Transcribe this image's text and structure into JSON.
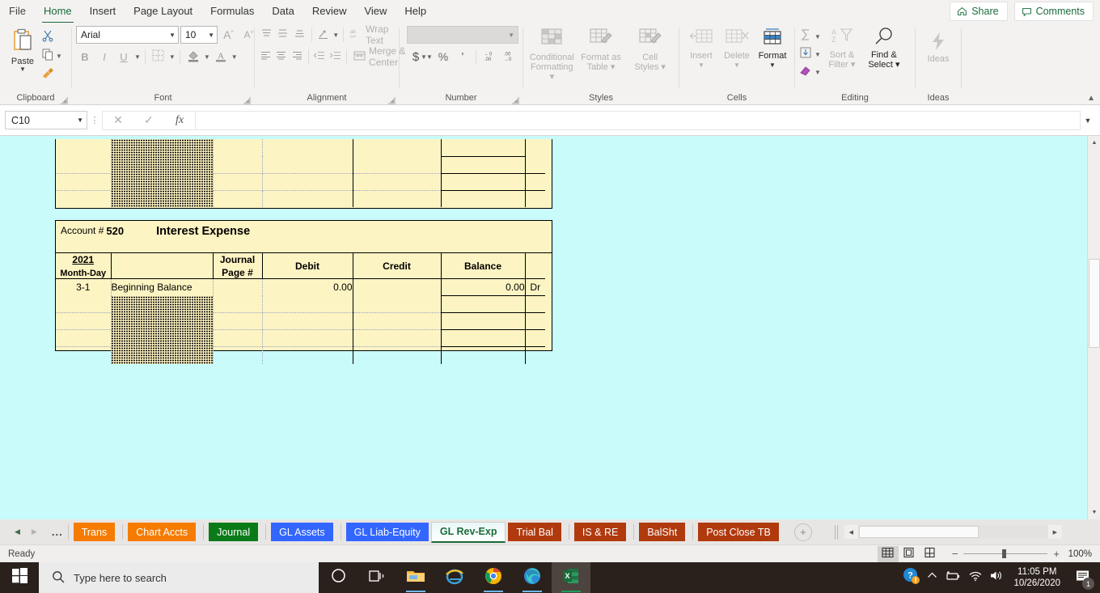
{
  "ribbon": {
    "tabs": [
      {
        "label": "File",
        "active": false
      },
      {
        "label": "Home",
        "active": true
      },
      {
        "label": "Insert",
        "active": false
      },
      {
        "label": "Page Layout",
        "active": false
      },
      {
        "label": "Formulas",
        "active": false
      },
      {
        "label": "Data",
        "active": false
      },
      {
        "label": "Review",
        "active": false
      },
      {
        "label": "View",
        "active": false
      },
      {
        "label": "Help",
        "active": false
      }
    ],
    "share_label": "Share",
    "comments_label": "Comments",
    "groups": {
      "clipboard": {
        "label": "Clipboard",
        "paste_label": "Paste",
        "cut_name": "cut-icon",
        "copy_name": "copy-icon",
        "format_painter_name": "format-painter-icon"
      },
      "font": {
        "label": "Font",
        "font_name": "Arial",
        "font_size": "10",
        "bold_label": "B",
        "italic_label": "I",
        "underline_label": "U",
        "grow_label": "A",
        "shrink_label": "A"
      },
      "alignment": {
        "label": "Alignment",
        "wrap_text_label": "Wrap Text",
        "merge_center_label": "Merge & Center"
      },
      "number": {
        "label": "Number",
        "format_value": "",
        "accounting_label": "$",
        "percent_label": "%",
        "comma_label": "'"
      },
      "styles": {
        "label": "Styles",
        "conditional_formatting_label": "Conditional\nFormatting",
        "conditional_formatting_l1": "Conditional",
        "conditional_formatting_l2": "Formatting",
        "format_as_table_l1": "Format as",
        "format_as_table_l2": "Table",
        "cell_styles_l1": "Cell",
        "cell_styles_l2": "Styles"
      },
      "cells": {
        "label": "Cells",
        "insert_label": "Insert",
        "delete_label": "Delete",
        "format_label": "Format"
      },
      "editing": {
        "label": "Editing",
        "sort_filter_l1": "Sort &",
        "sort_filter_l2": "Filter",
        "find_select_l1": "Find &",
        "find_select_l2": "Select"
      },
      "ideas": {
        "label": "Ideas",
        "ideas_button_label": "Ideas"
      }
    }
  },
  "formula_bar": {
    "name_box_value": "C10",
    "formula_value": "",
    "cancel_icon": "close-icon",
    "enter_icon": "check-icon",
    "function_icon": "fx-icon"
  },
  "worksheet": {
    "background_color": "#c9fbfb",
    "cell_fill_color": "#fdf4c3",
    "ledger_top": {
      "rows": [
        {
          "date": "",
          "desc": "",
          "jp": "",
          "debit": "",
          "credit": "",
          "balance": "",
          "dr": "",
          "hatched": true
        },
        {
          "date": "",
          "desc": "",
          "jp": "",
          "debit": "",
          "credit": "",
          "balance": "",
          "dr": "",
          "hatched": true
        },
        {
          "date": "",
          "desc": "",
          "jp": "",
          "debit": "",
          "credit": "",
          "balance": "",
          "dr": "",
          "hatched": true
        },
        {
          "date": "",
          "desc": "",
          "jp": "",
          "debit": "",
          "credit": "",
          "balance": "",
          "dr": "",
          "hatched": true
        }
      ]
    },
    "ledger_main": {
      "account_label": "Account #",
      "account_number": "520",
      "account_title": "Interest Expense",
      "headers": {
        "year": "2021",
        "month_day": "Month-Day",
        "description": "",
        "journal_l1": "Journal",
        "journal_l2": "Page #",
        "debit": "Debit",
        "credit": "Credit",
        "balance": "Balance",
        "dr_cr": ""
      },
      "rows": [
        {
          "date": "3-1",
          "desc": "Beginning Balance",
          "jp": "",
          "debit": "0.00",
          "credit": "",
          "balance": "0.00",
          "dr": "Dr",
          "hatched": false
        },
        {
          "date": "",
          "desc": "",
          "jp": "",
          "debit": "",
          "credit": "",
          "balance": "",
          "dr": "",
          "hatched": true
        },
        {
          "date": "",
          "desc": "",
          "jp": "",
          "debit": "",
          "credit": "",
          "balance": "",
          "dr": "",
          "hatched": true
        },
        {
          "date": "",
          "desc": "",
          "jp": "",
          "debit": "",
          "credit": "",
          "balance": "",
          "dr": "",
          "hatched": true
        },
        {
          "date": "",
          "desc": "",
          "jp": "",
          "debit": "",
          "credit": "",
          "balance": "",
          "dr": "",
          "hatched": true
        }
      ]
    }
  },
  "sheet_tabs": {
    "nav_prev_icon": "chevron-left-icon",
    "nav_next_icon": "chevron-right-icon",
    "nav_more_label": "...",
    "add_sheet_label": "+",
    "tabs": [
      {
        "label": "Trans",
        "color": "#f57c00",
        "active": false
      },
      {
        "label": "Chart Accts",
        "color": "#f57c00",
        "active": false
      },
      {
        "label": "Journal",
        "color": "#0a7b18",
        "active": false
      },
      {
        "label": "GL Assets",
        "color": "#3366ff",
        "active": false
      },
      {
        "label": "GL Liab-Equity",
        "color": "#3366ff",
        "active": false
      },
      {
        "label": "GL Rev-Exp",
        "color": "#ffffff",
        "active": true
      },
      {
        "label": "Trial Bal",
        "color": "#b03a0e",
        "active": false
      },
      {
        "label": "IS & RE",
        "color": "#b03a0e",
        "active": false
      },
      {
        "label": "BalSht",
        "color": "#b03a0e",
        "active": false
      },
      {
        "label": "Post Close TB",
        "color": "#b03a0e",
        "active": false
      }
    ]
  },
  "status_bar": {
    "status_text": "Ready",
    "view_normal_icon": "grid-view-icon",
    "view_page_layout_icon": "page-layout-icon",
    "view_page_break_icon": "page-break-icon",
    "zoom_out_label": "−",
    "zoom_in_label": "+",
    "zoom_value": "100%"
  },
  "taskbar": {
    "start_icon": "windows-logo-icon",
    "search_placeholder": "Type here to search",
    "search_icon": "search-icon",
    "cortana_icon": "cortana-circle-icon",
    "task_view_icon": "task-view-icon",
    "apps": [
      {
        "name": "file-explorer-icon"
      },
      {
        "name": "internet-explorer-icon"
      },
      {
        "name": "google-chrome-icon"
      },
      {
        "name": "microsoft-edge-icon"
      },
      {
        "name": "excel-icon"
      }
    ],
    "tray": {
      "help_icon": "help-question-icon",
      "chevron_up_icon": "chevron-up-icon",
      "battery_icon": "battery-icon",
      "network_icon": "wifi-icon",
      "volume_icon": "speaker-icon",
      "time": "11:05 PM",
      "date": "10/26/2020",
      "action_center_icon": "action-center-icon",
      "notification_count": "1"
    }
  }
}
